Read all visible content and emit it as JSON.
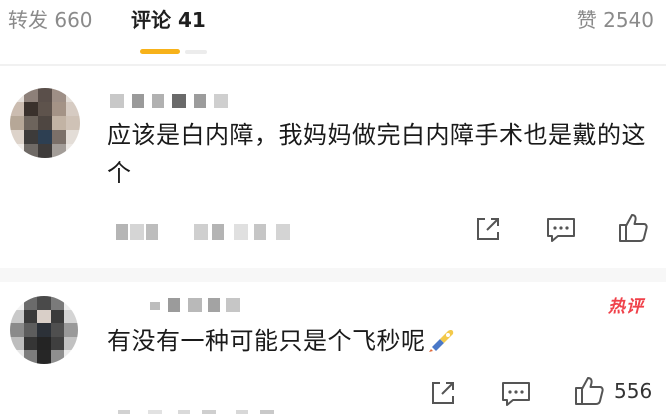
{
  "tabs": {
    "repost": "转发 660",
    "comment": "评论 41",
    "like": "赞 2540"
  },
  "comments": [
    {
      "text": "应该是白内障，我妈妈做完白内障手术也是戴的这个",
      "hot_badge": "",
      "like_count": ""
    },
    {
      "text": "有没有一种可能只是个飞秒呢",
      "emoji": "rocket-emoji",
      "hot_badge": "热评",
      "like_count": "556"
    }
  ],
  "icons": {
    "share": "share-icon",
    "reply": "comment-icon",
    "like": "thumbs-up-icon"
  },
  "colors": {
    "accent": "#f7b21a",
    "hot": "#f0414a",
    "muted_text": "#8a8a8a"
  }
}
